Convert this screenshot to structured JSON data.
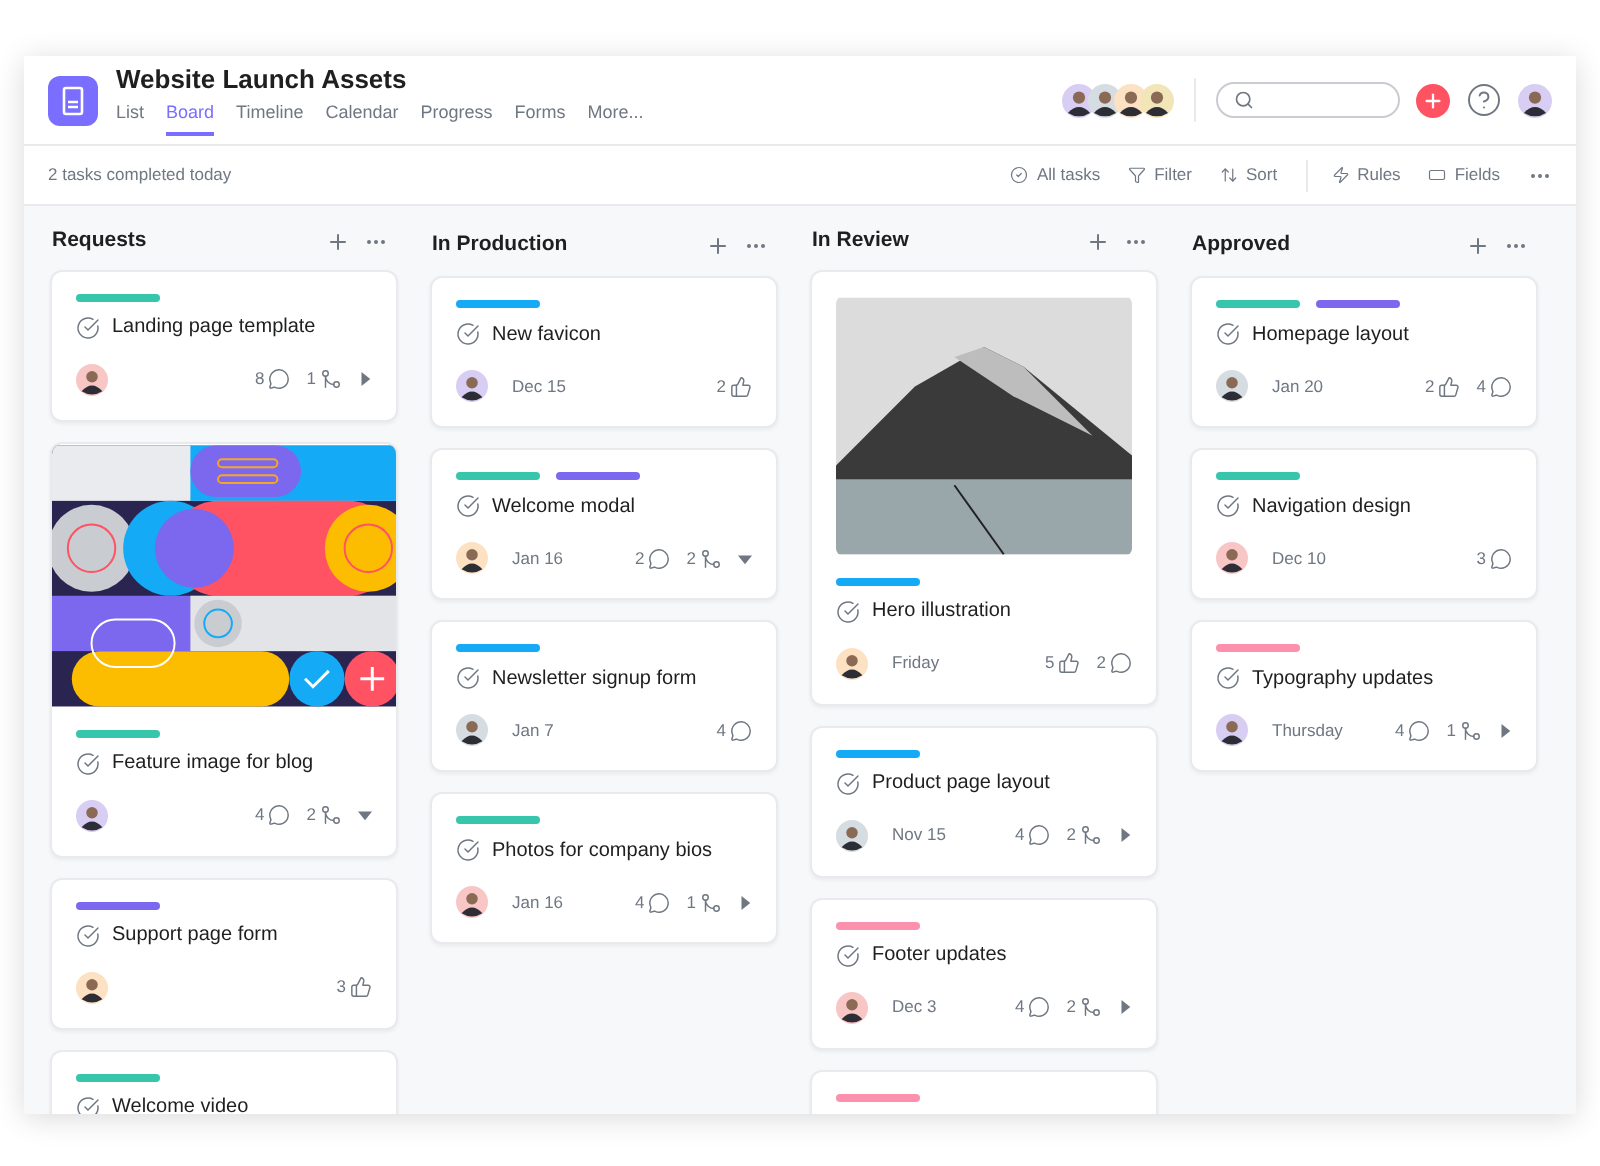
{
  "project": {
    "title": "Website Launch Assets"
  },
  "tabs": [
    {
      "label": "List",
      "selected": false
    },
    {
      "label": "Board",
      "selected": true
    },
    {
      "label": "Timeline",
      "selected": false
    },
    {
      "label": "Calendar",
      "selected": false
    },
    {
      "label": "Progress",
      "selected": false
    },
    {
      "label": "Forms",
      "selected": false
    },
    {
      "label": "More...",
      "selected": false
    }
  ],
  "status": "2 tasks completed today",
  "toolbar": [
    {
      "kind": "check",
      "label": "All tasks"
    },
    {
      "kind": "filter",
      "label": "Filter"
    },
    {
      "kind": "sort",
      "label": "Sort"
    },
    {
      "kind": "bolt",
      "label": "Rules"
    },
    {
      "kind": "fields",
      "label": "Fields"
    }
  ],
  "columns": [
    {
      "title": "Requests",
      "cards": [
        {
          "kind": "plain",
          "tags": [
            {
              "color": "#37c5ab"
            }
          ],
          "title": "Landing page template",
          "stats": [
            {
              "kind": "comments",
              "value": "8"
            },
            {
              "kind": "subtasks",
              "value": "1"
            }
          ],
          "subtasks_expanded": false
        },
        {
          "kind": "illustration",
          "tags": [
            {
              "color": "#37c5ab"
            }
          ],
          "title": "Feature image for blog",
          "stats": [
            {
              "kind": "comments",
              "value": "4"
            },
            {
              "kind": "subtasks",
              "value": "2"
            }
          ],
          "subtasks_expanded": true
        },
        {
          "kind": "plain",
          "tags": [
            {
              "color": "#7b68ee"
            }
          ],
          "title": "Support page form",
          "stats": [
            {
              "kind": "likes",
              "value": "3"
            }
          ]
        },
        {
          "kind": "plain",
          "tags": [
            {
              "color": "#37c5ab"
            }
          ],
          "title": "Welcome video"
        }
      ]
    },
    {
      "title": "In Production",
      "cards": [
        {
          "kind": "plain",
          "tags": [
            {
              "color": "#14aaf5"
            }
          ],
          "title": "New favicon",
          "date": "Dec 15",
          "stats": [
            {
              "kind": "likes",
              "value": "2"
            }
          ]
        },
        {
          "kind": "plain",
          "tags": [
            {
              "color": "#37c5ab"
            },
            {
              "color": "#7b68ee"
            }
          ],
          "title": "Welcome modal",
          "date": "Jan 16",
          "stats": [
            {
              "kind": "comments",
              "value": "2"
            },
            {
              "kind": "subtasks",
              "value": "2"
            }
          ],
          "subtasks_expanded": true
        },
        {
          "kind": "plain",
          "tags": [
            {
              "color": "#14aaf5"
            }
          ],
          "title": "Newsletter signup form",
          "date": "Jan 7",
          "stats": [
            {
              "kind": "comments",
              "value": "4"
            }
          ]
        },
        {
          "kind": "plain",
          "tags": [
            {
              "color": "#37c5ab"
            }
          ],
          "title": "Photos for company bios",
          "date": "Jan 16",
          "stats": [
            {
              "kind": "comments",
              "value": "4"
            },
            {
              "kind": "subtasks",
              "value": "1"
            }
          ],
          "subtasks_expanded": false
        }
      ]
    },
    {
      "title": "In Review",
      "cards": [
        {
          "kind": "photo",
          "tags": [
            {
              "color": "#14aaf5"
            }
          ],
          "title": "Hero illustration",
          "date": "Friday",
          "stats": [
            {
              "kind": "likes",
              "value": "5"
            },
            {
              "kind": "comments",
              "value": "2"
            }
          ]
        },
        {
          "kind": "plain",
          "tags": [
            {
              "color": "#14aaf5"
            }
          ],
          "title": "Product page layout",
          "date": "Nov 15",
          "stats": [
            {
              "kind": "comments",
              "value": "4"
            },
            {
              "kind": "subtasks",
              "value": "2"
            }
          ],
          "subtasks_expanded": false
        },
        {
          "kind": "plain",
          "tags": [
            {
              "color": "#fc91ad"
            }
          ],
          "title": "Footer updates",
          "date": "Dec 3",
          "stats": [
            {
              "kind": "comments",
              "value": "4"
            },
            {
              "kind": "subtasks",
              "value": "2"
            }
          ],
          "subtasks_expanded": false
        },
        {
          "kind": "plain",
          "tags": [
            {
              "color": "#fc91ad"
            }
          ]
        }
      ]
    },
    {
      "title": "Approved",
      "cards": [
        {
          "kind": "plain",
          "tags": [
            {
              "color": "#37c5ab"
            },
            {
              "color": "#7b68ee"
            }
          ],
          "title": "Homepage layout",
          "date": "Jan 20",
          "stats": [
            {
              "kind": "likes",
              "value": "2"
            },
            {
              "kind": "comments",
              "value": "4"
            }
          ]
        },
        {
          "kind": "plain",
          "tags": [
            {
              "color": "#37c5ab"
            }
          ],
          "title": "Navigation design",
          "date": "Dec 10",
          "stats": [
            {
              "kind": "comments",
              "value": "3"
            }
          ]
        },
        {
          "kind": "plain",
          "tags": [
            {
              "color": "#fc91ad"
            }
          ],
          "title": "Typography updates",
          "date": "Thursday",
          "stats": [
            {
              "kind": "comments",
              "value": "4"
            },
            {
              "kind": "subtasks",
              "value": "1"
            }
          ],
          "subtasks_expanded": false
        }
      ]
    }
  ]
}
